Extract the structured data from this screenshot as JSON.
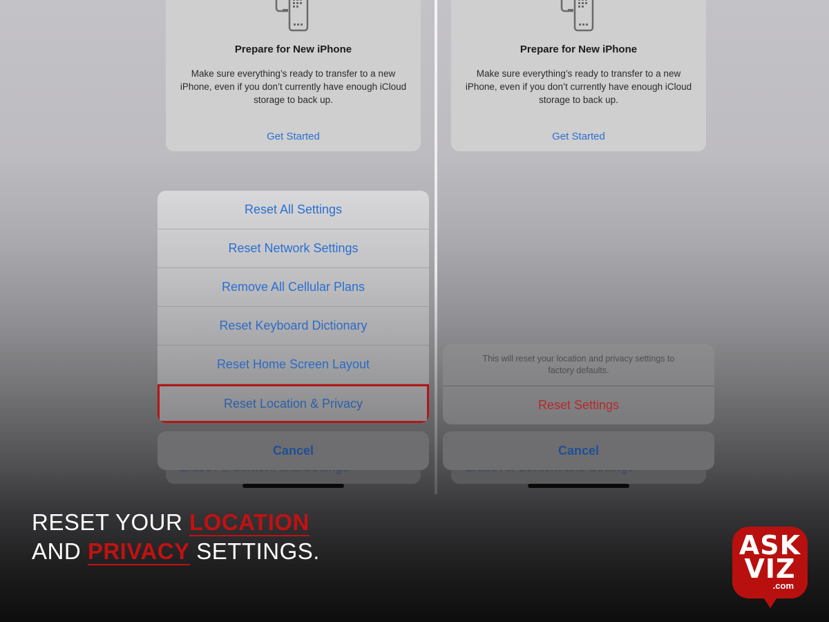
{
  "left_screen": {
    "card": {
      "icon": "phone-transfer-icon",
      "title": "Prepare for New iPhone",
      "description": "Make sure everything’s ready to transfer to a new iPhone, even if you don’t currently have enough iCloud storage to back up.",
      "link": "Get Started"
    },
    "action_sheet": {
      "items": [
        {
          "label": "Reset All Settings"
        },
        {
          "label": "Reset Network Settings"
        },
        {
          "label": "Remove All Cellular Plans"
        },
        {
          "label": "Reset Keyboard Dictionary"
        },
        {
          "label": "Reset Home Screen Layout"
        },
        {
          "label": "Reset Location & Privacy",
          "highlighted": true
        }
      ]
    },
    "behind_text": "Erase All Content and Settings",
    "cancel_label": "Cancel"
  },
  "right_screen": {
    "card": {
      "icon": "phone-transfer-icon",
      "title": "Prepare for New iPhone",
      "description": "Make sure everything’s ready to transfer to a new iPhone, even if you don’t currently have enough iCloud storage to back up.",
      "link": "Get Started"
    },
    "confirm_sheet": {
      "message": "This will reset your location and privacy settings to factory defaults.",
      "button": "Reset Settings"
    },
    "behind_text": "Erase All Content and Settings",
    "cancel_label": "Cancel"
  },
  "caption": {
    "line1_prefix": "RESET YOUR ",
    "line1_accent": "LOCATION",
    "line2_prefix": "AND ",
    "line2_accent": "PRIVACY",
    "line2_suffix": " SETTINGS."
  },
  "logo": {
    "line1": "ASK",
    "line2": "VIZ",
    "line3": ".com"
  },
  "colors": {
    "ios_blue": "#2a6fd0",
    "destructive_red": "#b52a2a",
    "highlight_border": "#b21616",
    "brand_red": "#b8100f"
  }
}
